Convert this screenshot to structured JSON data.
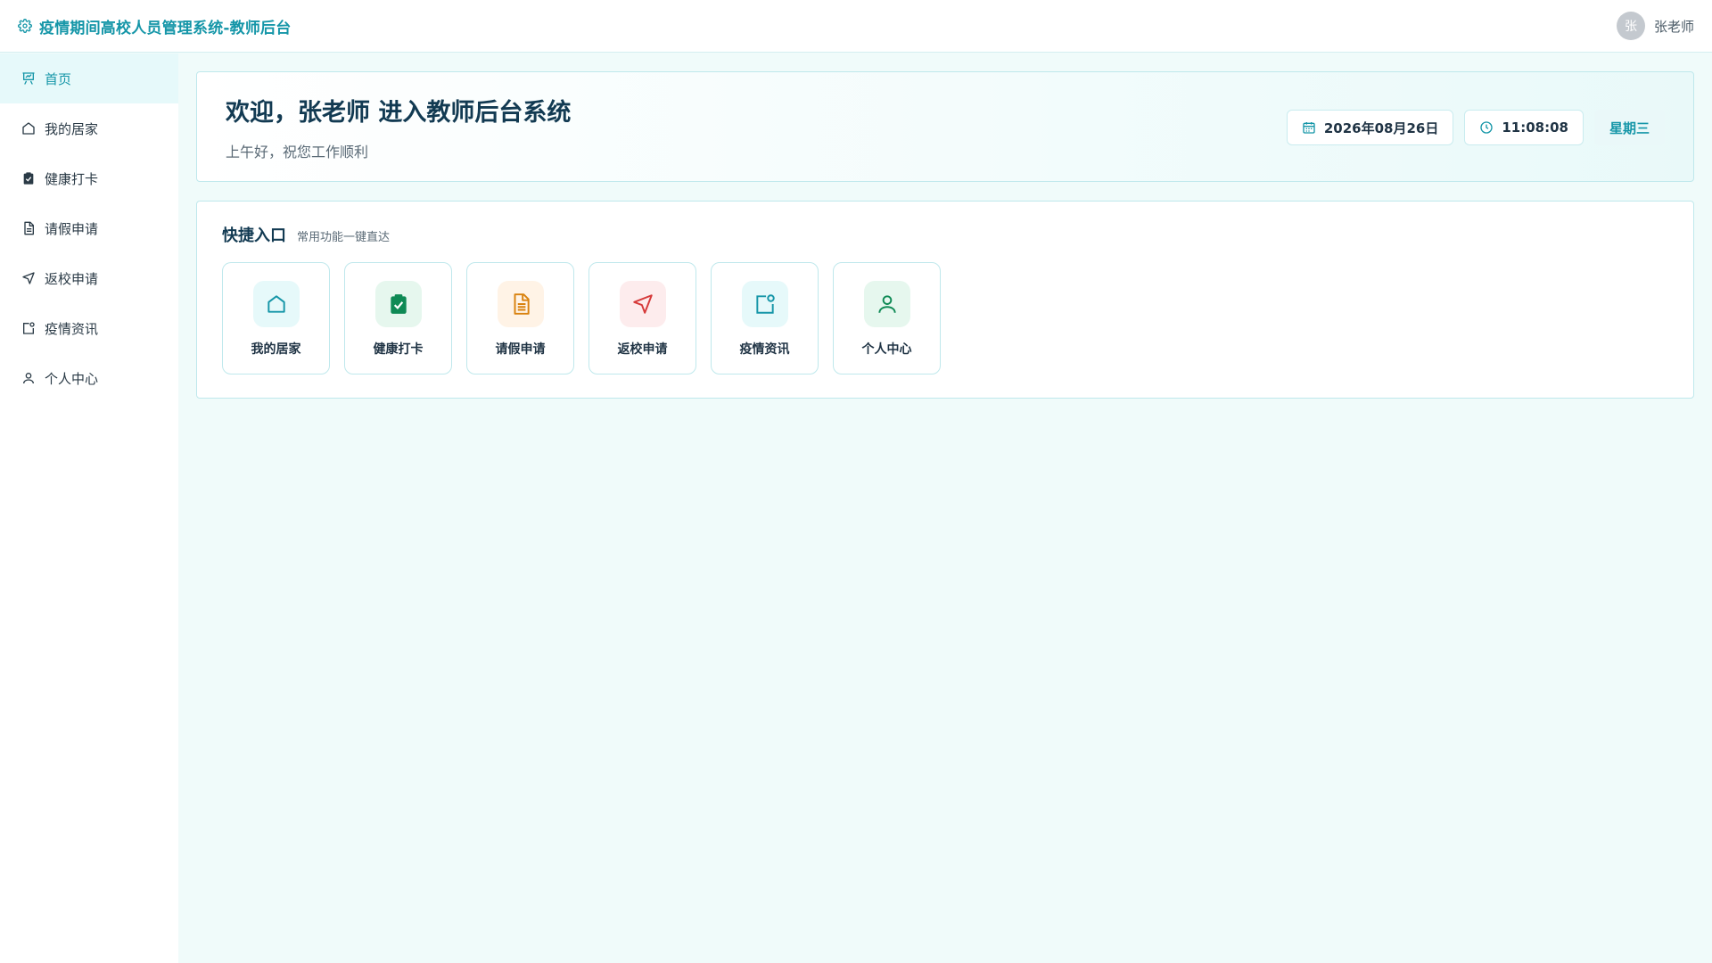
{
  "header": {
    "title": "疫情期间高校人员管理系统-教师后台",
    "brand_icon": "gear-icon",
    "user": {
      "avatar_text": "张",
      "name": "张老师"
    }
  },
  "sidebar": {
    "items": [
      {
        "label": "首页",
        "icon": "dashboard-icon",
        "active": true
      },
      {
        "label": "我的居家",
        "icon": "home-icon"
      },
      {
        "label": "健康打卡",
        "icon": "clipboard-check-icon"
      },
      {
        "label": "请假申请",
        "icon": "document-icon"
      },
      {
        "label": "返校申请",
        "icon": "send-icon"
      },
      {
        "label": "疫情资讯",
        "icon": "news-icon"
      },
      {
        "label": "个人中心",
        "icon": "user-icon"
      }
    ]
  },
  "welcome": {
    "title": "欢迎，张老师 进入教师后台系统",
    "subtitle": "上午好，祝您工作顺利",
    "date": "2026年08月26日",
    "time": "11:08:08",
    "weekday": "星期三"
  },
  "quick": {
    "title": "快捷入口",
    "subtitle": "常用功能一键直达",
    "tiles": [
      {
        "label": "我的居家",
        "icon": "home-icon",
        "color": "#1596a8"
      },
      {
        "label": "健康打卡",
        "icon": "clipboard-check-icon",
        "color": "#0f8a55"
      },
      {
        "label": "请假申请",
        "icon": "document-icon",
        "color": "#d9820f"
      },
      {
        "label": "返校申请",
        "icon": "send-icon",
        "color": "#d63a3a"
      },
      {
        "label": "疫情资讯",
        "icon": "news-icon",
        "color": "#1596a8"
      },
      {
        "label": "个人中心",
        "icon": "user-icon",
        "color": "#0f8a55"
      }
    ]
  },
  "colors": {
    "accent": "#1596a8",
    "background": "#f0fbfa",
    "border": "#bfe8ec"
  }
}
